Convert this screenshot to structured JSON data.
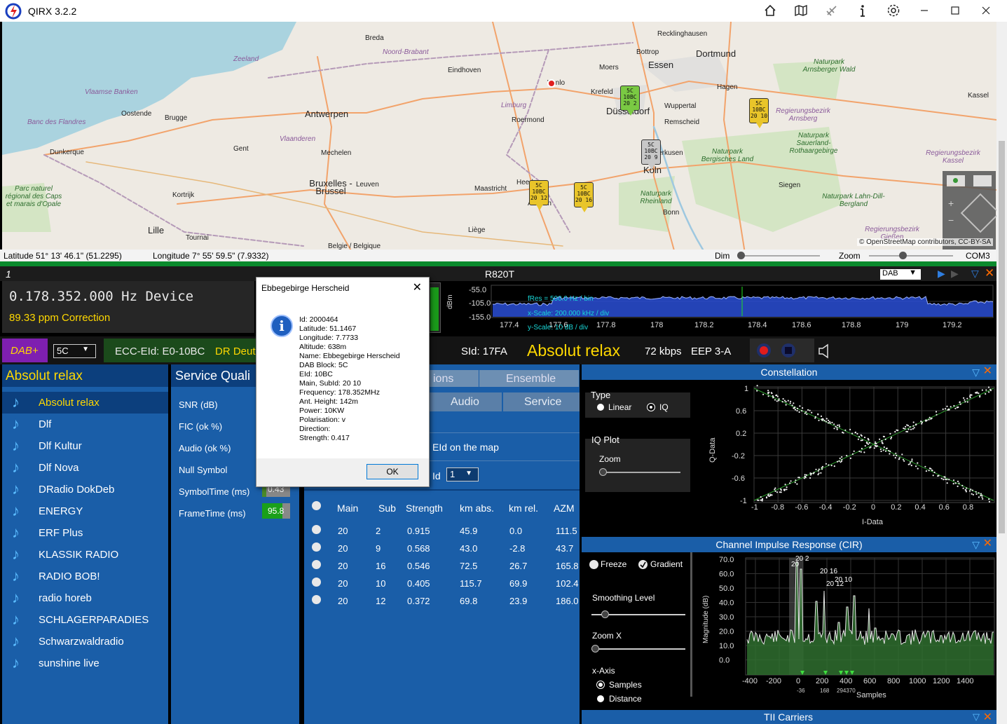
{
  "app": {
    "title": "QIRX 3.2.2"
  },
  "titlebar_icons": [
    "home-icon",
    "map-icon",
    "satellite-icon",
    "info-icon",
    "settings-icon"
  ],
  "map": {
    "labels": [
      {
        "t": "Breda"
      },
      {
        "t": "Noord-Brabant"
      },
      {
        "t": "Zeeland"
      },
      {
        "t": "Eindhoven"
      },
      {
        "t": "Venlo"
      },
      {
        "t": "Vlaamse Banken"
      },
      {
        "t": "Oostende"
      },
      {
        "t": "Brugge"
      },
      {
        "t": "Antwerpen"
      },
      {
        "t": "Banc des Flandres"
      },
      {
        "t": "Limburg"
      },
      {
        "t": "Roermond"
      },
      {
        "t": "Krefeld"
      },
      {
        "t": "Düsseldorf"
      },
      {
        "t": "Moers"
      },
      {
        "t": "Essen"
      },
      {
        "t": "Bottrop"
      },
      {
        "t": "Dortmund"
      },
      {
        "t": "Recklinghausen"
      },
      {
        "t": "Hagen"
      },
      {
        "t": "Wuppertal"
      },
      {
        "t": "Remscheid"
      },
      {
        "t": "Naturpark Arnsberger Wald"
      },
      {
        "t": "Kassel"
      },
      {
        "t": "Regierungsbezirk Arnsberg"
      },
      {
        "t": "Naturpark Sauerland-Rothaargebirge"
      },
      {
        "t": "Dunkerque"
      },
      {
        "t": "Gent"
      },
      {
        "t": "Mechelen"
      },
      {
        "t": "Vlaanderen"
      },
      {
        "t": "Leverkusen"
      },
      {
        "t": "Köln"
      },
      {
        "t": "Naturpark Bergisches Land"
      },
      {
        "t": "Siegen"
      },
      {
        "t": "Regierungsbezirk Kassel"
      },
      {
        "t": "Bruxelles - Brussel"
      },
      {
        "t": "Leuven"
      },
      {
        "t": "Maastricht"
      },
      {
        "t": "Heerlen"
      },
      {
        "t": "Aachen"
      },
      {
        "t": "Naturpark Rheinland"
      },
      {
        "t": "Bonn"
      },
      {
        "t": "Naturpark Lahn-Dill-Bergland"
      },
      {
        "t": "Parc naturel régional des Caps et marais d'Opale"
      },
      {
        "t": "Kortrijk"
      },
      {
        "t": "Lille"
      },
      {
        "t": "Tournai"
      },
      {
        "t": "Liège"
      },
      {
        "t": "Regierungsbezirk Gießen"
      },
      {
        "t": "Belgie / Belgique"
      }
    ],
    "markers": [
      {
        "l1": "5C",
        "l2": "10BC",
        "l3": "20 2",
        "color": "#7ac943"
      },
      {
        "l1": "5C",
        "l2": "10BC",
        "l3": "20 10",
        "color": "#e9c52a"
      },
      {
        "l1": "5C",
        "l2": "10BC",
        "l3": "20 9",
        "color": "#c8c8c8"
      },
      {
        "l1": "5C",
        "l2": "10BC",
        "l3": "20 12",
        "color": "#e9c52a"
      },
      {
        "l1": "5C",
        "l2": "10BC",
        "l3": "20 16",
        "color": "#e9c52a"
      }
    ],
    "attribution": "© OpenStreetMap contributors, CC-BY-SA"
  },
  "status": {
    "latitude": "Latitude  51° 13' 46.1\" (51.2295)",
    "longitude": "Longitude  7° 55' 59.5\" (7.9332)",
    "dim": "Dim",
    "zoom": "Zoom",
    "com": "COM3"
  },
  "receiver": {
    "index": "1",
    "device_name": "R820T",
    "mode": "DAB",
    "frequency": "0.178.352.000 Hz Device",
    "correction": "89.33 ppm Correction",
    "spectrum": {
      "y_labels": [
        "-55.0",
        "-105.0",
        "-155.0"
      ],
      "y_unit": "dBm",
      "x_labels": [
        "177.4",
        "177.6",
        "177.8",
        "178",
        "178.2",
        "178.4",
        "178.6",
        "178.8",
        "179",
        "179.2"
      ],
      "fres": "fRes = 500.0 Hz / bin",
      "xscale": "x-Scale: 200.000 kHz / div",
      "yscale": "y-Scale: 10 dB / div"
    }
  },
  "service_bar": {
    "dab_plus": "DAB+",
    "block": "5C",
    "ecc": "ECC-EId: E0-10BC",
    "ensemble": "DR Deut",
    "sid": "SId: 17FA",
    "service_name": "Absolut relax",
    "bitrate": "72 kbps",
    "eep": "EEP 3-A"
  },
  "services": {
    "header": "Absolut relax",
    "items": [
      "Absolut relax",
      "Dlf",
      "Dlf Kultur",
      "Dlf Nova",
      "DRadio DokDeb",
      "ENERGY",
      "ERF Plus",
      "KLASSIK RADIO",
      "RADIO BOB!",
      "radio horeb",
      "SCHLAGERPARADIES",
      "Schwarzwaldradio",
      "sunshine live"
    ]
  },
  "service_quality": {
    "header": "Service Quali",
    "items": [
      {
        "label": "SNR (dB)"
      },
      {
        "label": "FIC (ok %)"
      },
      {
        "label": "Audio (ok %)"
      },
      {
        "label": "Null Symbol"
      },
      {
        "label": "SymbolTime (ms)",
        "value": "0.43",
        "level": 0.15,
        "color": "#4a8a2a"
      },
      {
        "label": "FrameTime (ms)",
        "value": "95.8",
        "level": 0.72,
        "color": "#1aa01a"
      }
    ]
  },
  "tabs": {
    "row1": [
      "ions",
      "Ensemble"
    ],
    "row2": [
      "Audio",
      "Service"
    ]
  },
  "tii": {
    "eid_label": "EId on the map",
    "id_label": "Id",
    "id_value": "1",
    "columns": [
      "Main",
      "Sub",
      "Strength",
      "km abs.",
      "km rel.",
      "AZM"
    ],
    "rows": [
      [
        "20",
        "2",
        "0.915",
        "45.9",
        "0.0",
        "111.5"
      ],
      [
        "20",
        "9",
        "0.568",
        "43.0",
        "-2.8",
        "43.7"
      ],
      [
        "20",
        "16",
        "0.546",
        "72.5",
        "26.7",
        "165.8"
      ],
      [
        "20",
        "10",
        "0.405",
        "115.7",
        "69.9",
        "102.4"
      ],
      [
        "20",
        "12",
        "0.372",
        "69.8",
        "23.9",
        "186.0"
      ]
    ]
  },
  "dialog": {
    "title": "Ebbegebirge Herscheid",
    "lines": [
      "Id: 2000464",
      "Latitude: 51.1467",
      "Longitude: 7.7733",
      "Altitude: 638m",
      "Name: Ebbegebirge Herscheid",
      "DAB Block: 5C",
      "EId: 10BC",
      "Main, SubId: 20 10",
      "Frequency: 178.352MHz",
      "Ant. Height: 142m",
      "Power: 10KW",
      "Polarisation: v",
      "Direction:",
      "Strength: 0.417"
    ],
    "ok": "OK"
  },
  "constellation": {
    "header": "Constellation",
    "type_label": "Type",
    "opt_linear": "Linear",
    "opt_iq": "IQ",
    "iqplot_label": "IQ Plot",
    "zoom_label": "Zoom",
    "y_labels": [
      "1",
      "0.6",
      "0.2",
      "-0.2",
      "-0.6",
      "-1"
    ],
    "x_labels": [
      "-1",
      "-0.8",
      "-0.6",
      "-0.4",
      "-0.2",
      "0",
      "0.2",
      "0.4",
      "0.6",
      "0.8"
    ],
    "xlabel": "I-Data",
    "ylabel": "Q-Data"
  },
  "cir": {
    "header": "Channel Impulse Response (CIR)",
    "freeze": "Freeze",
    "gradient": "Gradient",
    "smoothing": "Smoothing Level",
    "zoomx": "Zoom X",
    "xaxis": "x-Axis",
    "samples_opt": "Samples",
    "distance_opt": "Distance",
    "y_labels": [
      "70.0",
      "60.0",
      "50.0",
      "40.0",
      "30.0",
      "20.0",
      "10.0",
      "0.0"
    ],
    "x_labels": [
      "-400",
      "-200",
      "0",
      "200",
      "400",
      "600",
      "800",
      "1000",
      "1200",
      "1400"
    ],
    "xlabel": "Samples",
    "ylabel": "Magnitude (dB)",
    "peak_labels": [
      "20 2",
      "20",
      "20 16",
      "20 10",
      "20 12"
    ],
    "marker_labels": [
      "-36",
      "168",
      "294370"
    ]
  },
  "tii_carriers": {
    "header": "TII Carriers"
  }
}
